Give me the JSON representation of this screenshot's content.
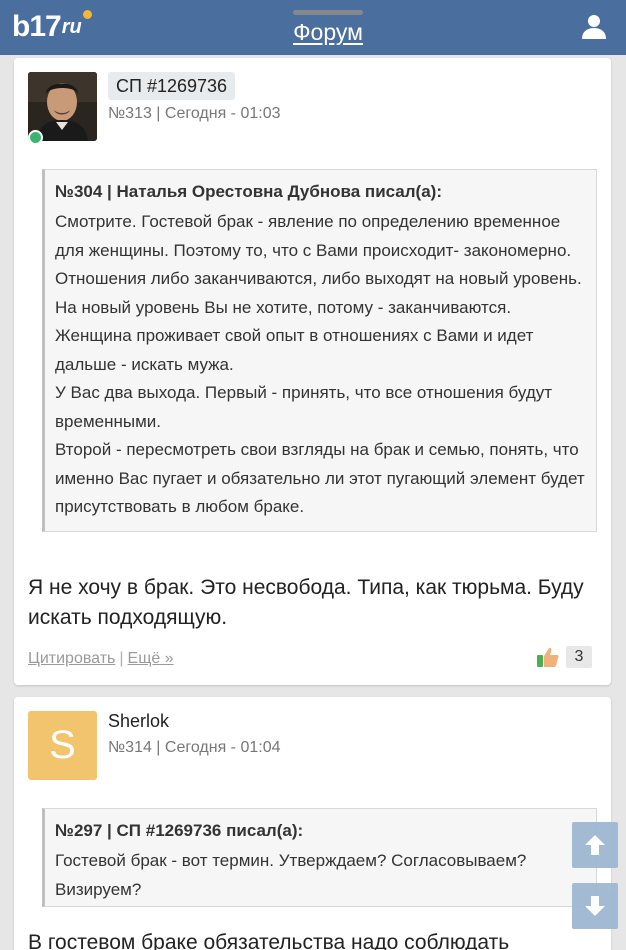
{
  "header": {
    "logo_text": "b17",
    "logo_suffix": "ru",
    "title": "Форум",
    "colors": {
      "bar": "#4a6f9e",
      "logo_dot": "#f5b731"
    },
    "icons": {
      "user": "user-icon"
    }
  },
  "posts": [
    {
      "author": "СП #1269736",
      "meta": "№313 | Сегодня - 01:03",
      "online": true,
      "quote": {
        "head": "№304 | Наталья Орестовна Дубнова писал(а):",
        "paragraphs": [
          "Смотрите. Гостевой брак - явление по определению временное для женщины. Поэтому то, что с Вами происходит- закономерно. Отношения либо заканчиваются, либо выходят на новый уровень. На новый уровень Вы не хотите, потому - заканчиваются. Женщина проживает свой опыт в отношениях с Вами и идет дальше - искать мужа.",
          "У Вас два выхода. Первый - принять, что все отношения будут временными.",
          "Второй - пересмотреть свои взгляды на брак и семью, понять, что именно Вас пугает и обязательно ли этот пугающий элемент будет присутствовать в любом браке."
        ]
      },
      "text": "Я не хочу в брак. Это несвобода. Типа, как тюрьма. Буду искать подходящую.",
      "actions": {
        "quote": "Цитировать",
        "separator": "|",
        "more": "Ещё »"
      },
      "likes": "3"
    },
    {
      "author": "Sherlok",
      "avatar_letter": "S",
      "meta": "№314 | Сегодня - 01:04",
      "quote": {
        "head": "№297 | СП #1269736 писал(а):",
        "paragraphs": [
          "Гостевой брак - вот термин. Утверждаем? Согласовываем? Визируем?"
        ]
      },
      "text": "В гостевом браке обязательства надо соблюдать"
    }
  ],
  "scroll": {
    "up_icon": "arrow-up-icon",
    "down_icon": "arrow-down-icon"
  }
}
